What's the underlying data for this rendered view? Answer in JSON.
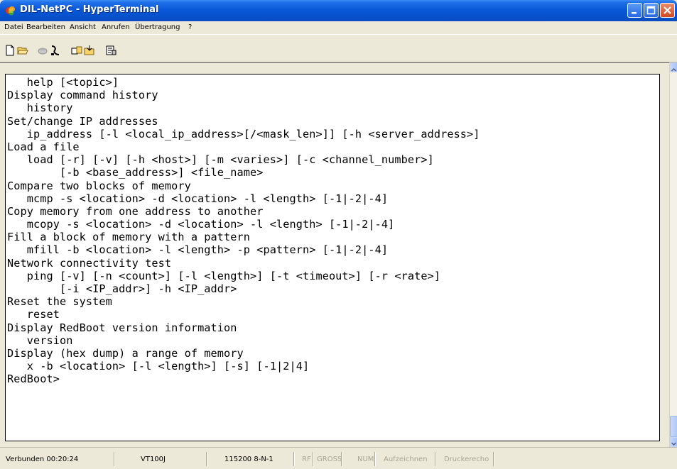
{
  "window": {
    "title": "DIL-NetPC - HyperTerminal",
    "controls": [
      "minimize-icon",
      "maximize-icon",
      "close-icon"
    ]
  },
  "menubar": {
    "items": [
      "Datei",
      "Bearbeiten",
      "Ansicht",
      "Anrufen",
      "Übertragung",
      "?"
    ]
  },
  "toolbar": {
    "icons": [
      "new-connection-icon",
      "open-icon",
      "disconnect-icon",
      "call-icon",
      "send-icon",
      "receive-icon",
      "properties-icon"
    ]
  },
  "terminal": {
    "lines": [
      "   help [<topic>]",
      "Display command history",
      "   history",
      "Set/change IP addresses",
      "   ip_address [-l <local_ip_address>[/<mask_len>]] [-h <server_address>]",
      "Load a file",
      "   load [-r] [-v] [-h <host>] [-m <varies>] [-c <channel_number>]",
      "        [-b <base_address>] <file_name>",
      "Compare two blocks of memory",
      "   mcmp -s <location> -d <location> -l <length> [-1|-2|-4]",
      "Copy memory from one address to another",
      "   mcopy -s <location> -d <location> -l <length> [-1|-2|-4]",
      "Fill a block of memory with a pattern",
      "   mfill -b <location> -l <length> -p <pattern> [-1|-2|-4]",
      "Network connectivity test",
      "   ping [-v] [-n <count>] [-l <length>] [-t <timeout>] [-r <rate>]",
      "        [-i <IP_addr>] -h <IP_addr>",
      "Reset the system",
      "   reset",
      "Display RedBoot version information",
      "   version",
      "Display (hex dump) a range of memory",
      "   x -b <location> [-l <length>] [-s] [-1|2|4]",
      "RedBoot>"
    ]
  },
  "statusbar": {
    "connected": "Verbunden 00:20:24",
    "emulation": "VT100J",
    "port_settings": "115200 8-N-1",
    "rf": "RF",
    "gross": "GROSS",
    "num": "NUM",
    "capture": "Aufzeichnen",
    "print_echo": "Druckerecho"
  },
  "colors": {
    "titlebar": "#0a58d8",
    "chrome": "#ece9d8",
    "terminal_bg": "#ffffff",
    "terminal_text": "#000000"
  }
}
